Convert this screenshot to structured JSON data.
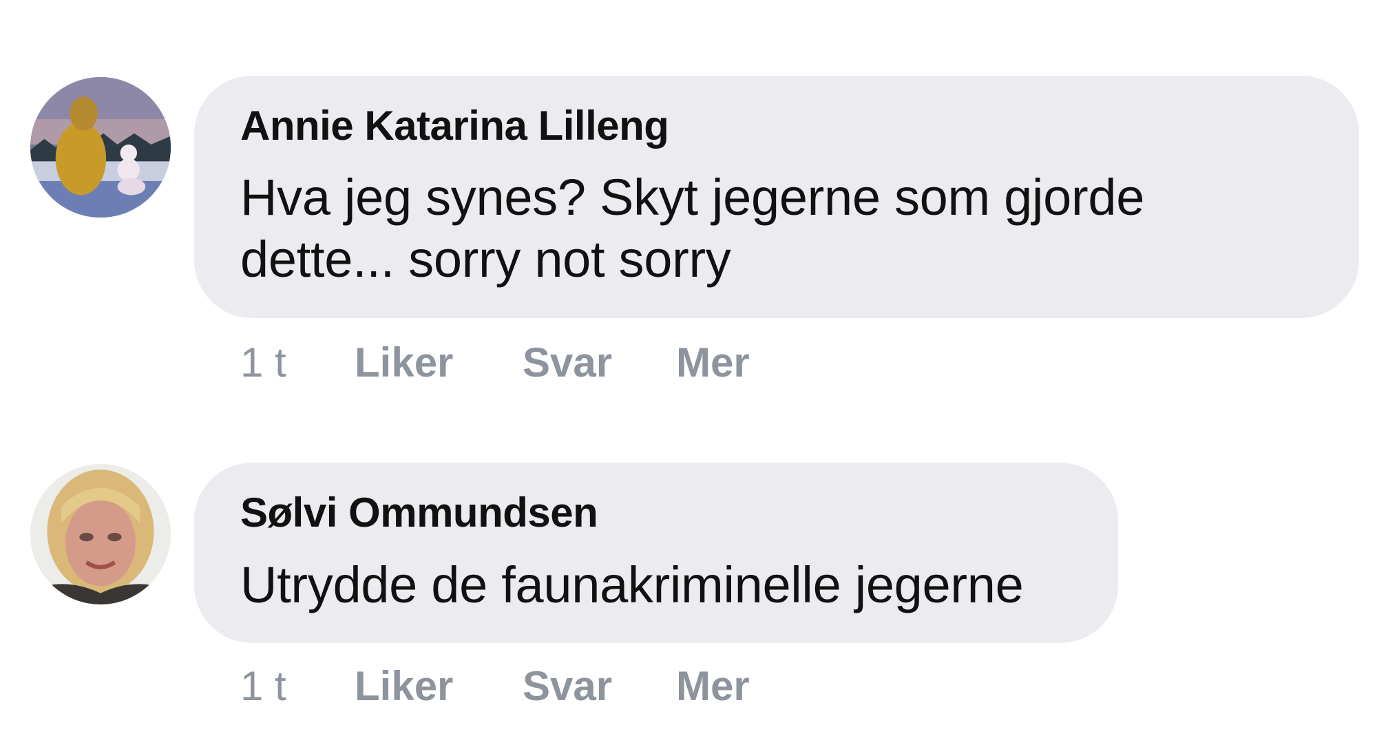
{
  "comments": [
    {
      "author": "Annie Katarina Lilleng",
      "text": "Hva jeg synes? Skyt jegerne som gjorde dette... sorry not sorry",
      "time": "1 t",
      "like_label": "Liker",
      "reply_label": "Svar",
      "more_label": "Mer"
    },
    {
      "author": "Sølvi Ommundsen",
      "text": "Utrydde de faunakriminelle jegerne",
      "time": "1 t",
      "like_label": "Liker",
      "reply_label": "Svar",
      "more_label": "Mer"
    }
  ]
}
